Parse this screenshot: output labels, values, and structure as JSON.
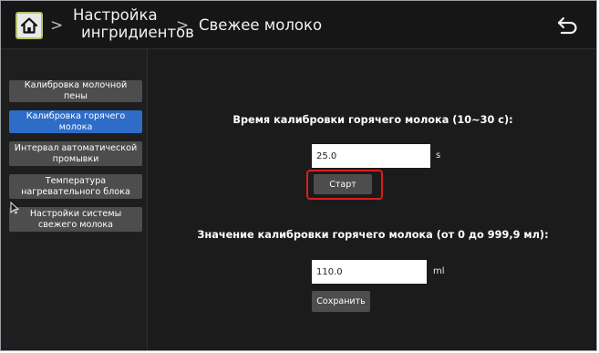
{
  "header": {
    "home_icon": "home-icon",
    "breadcrumb_parent_line1": "Настройка",
    "breadcrumb_parent_line2": "ингридиентов",
    "breadcrumb_current": "Свежее молоко",
    "separator": ">",
    "back_icon": "back-arrow-icon"
  },
  "sidebar": {
    "items": [
      {
        "label": "Калибровка молочной пены"
      },
      {
        "label": "Калибровка горячего молока"
      },
      {
        "label": "Интервал автоматической промывки"
      },
      {
        "label": "Температура нагревательного блока"
      },
      {
        "label": "Настройки системы свежего молока"
      }
    ],
    "active_index": 1
  },
  "main": {
    "time_heading": "Время калибровки горячего молока (10~30 с):",
    "time_value": "25.0",
    "time_unit": "s",
    "start_label": "Старт",
    "value_heading": "Значение калибровки горячего молока (от 0 до 999,9 мл):",
    "value_value": "110.0",
    "value_unit": "ml",
    "save_label": "Сохранить"
  },
  "colors": {
    "active": "#2d6cc7",
    "button": "#4d4d4d",
    "highlight": "#e01b1b",
    "background": "#1b1b1b"
  }
}
